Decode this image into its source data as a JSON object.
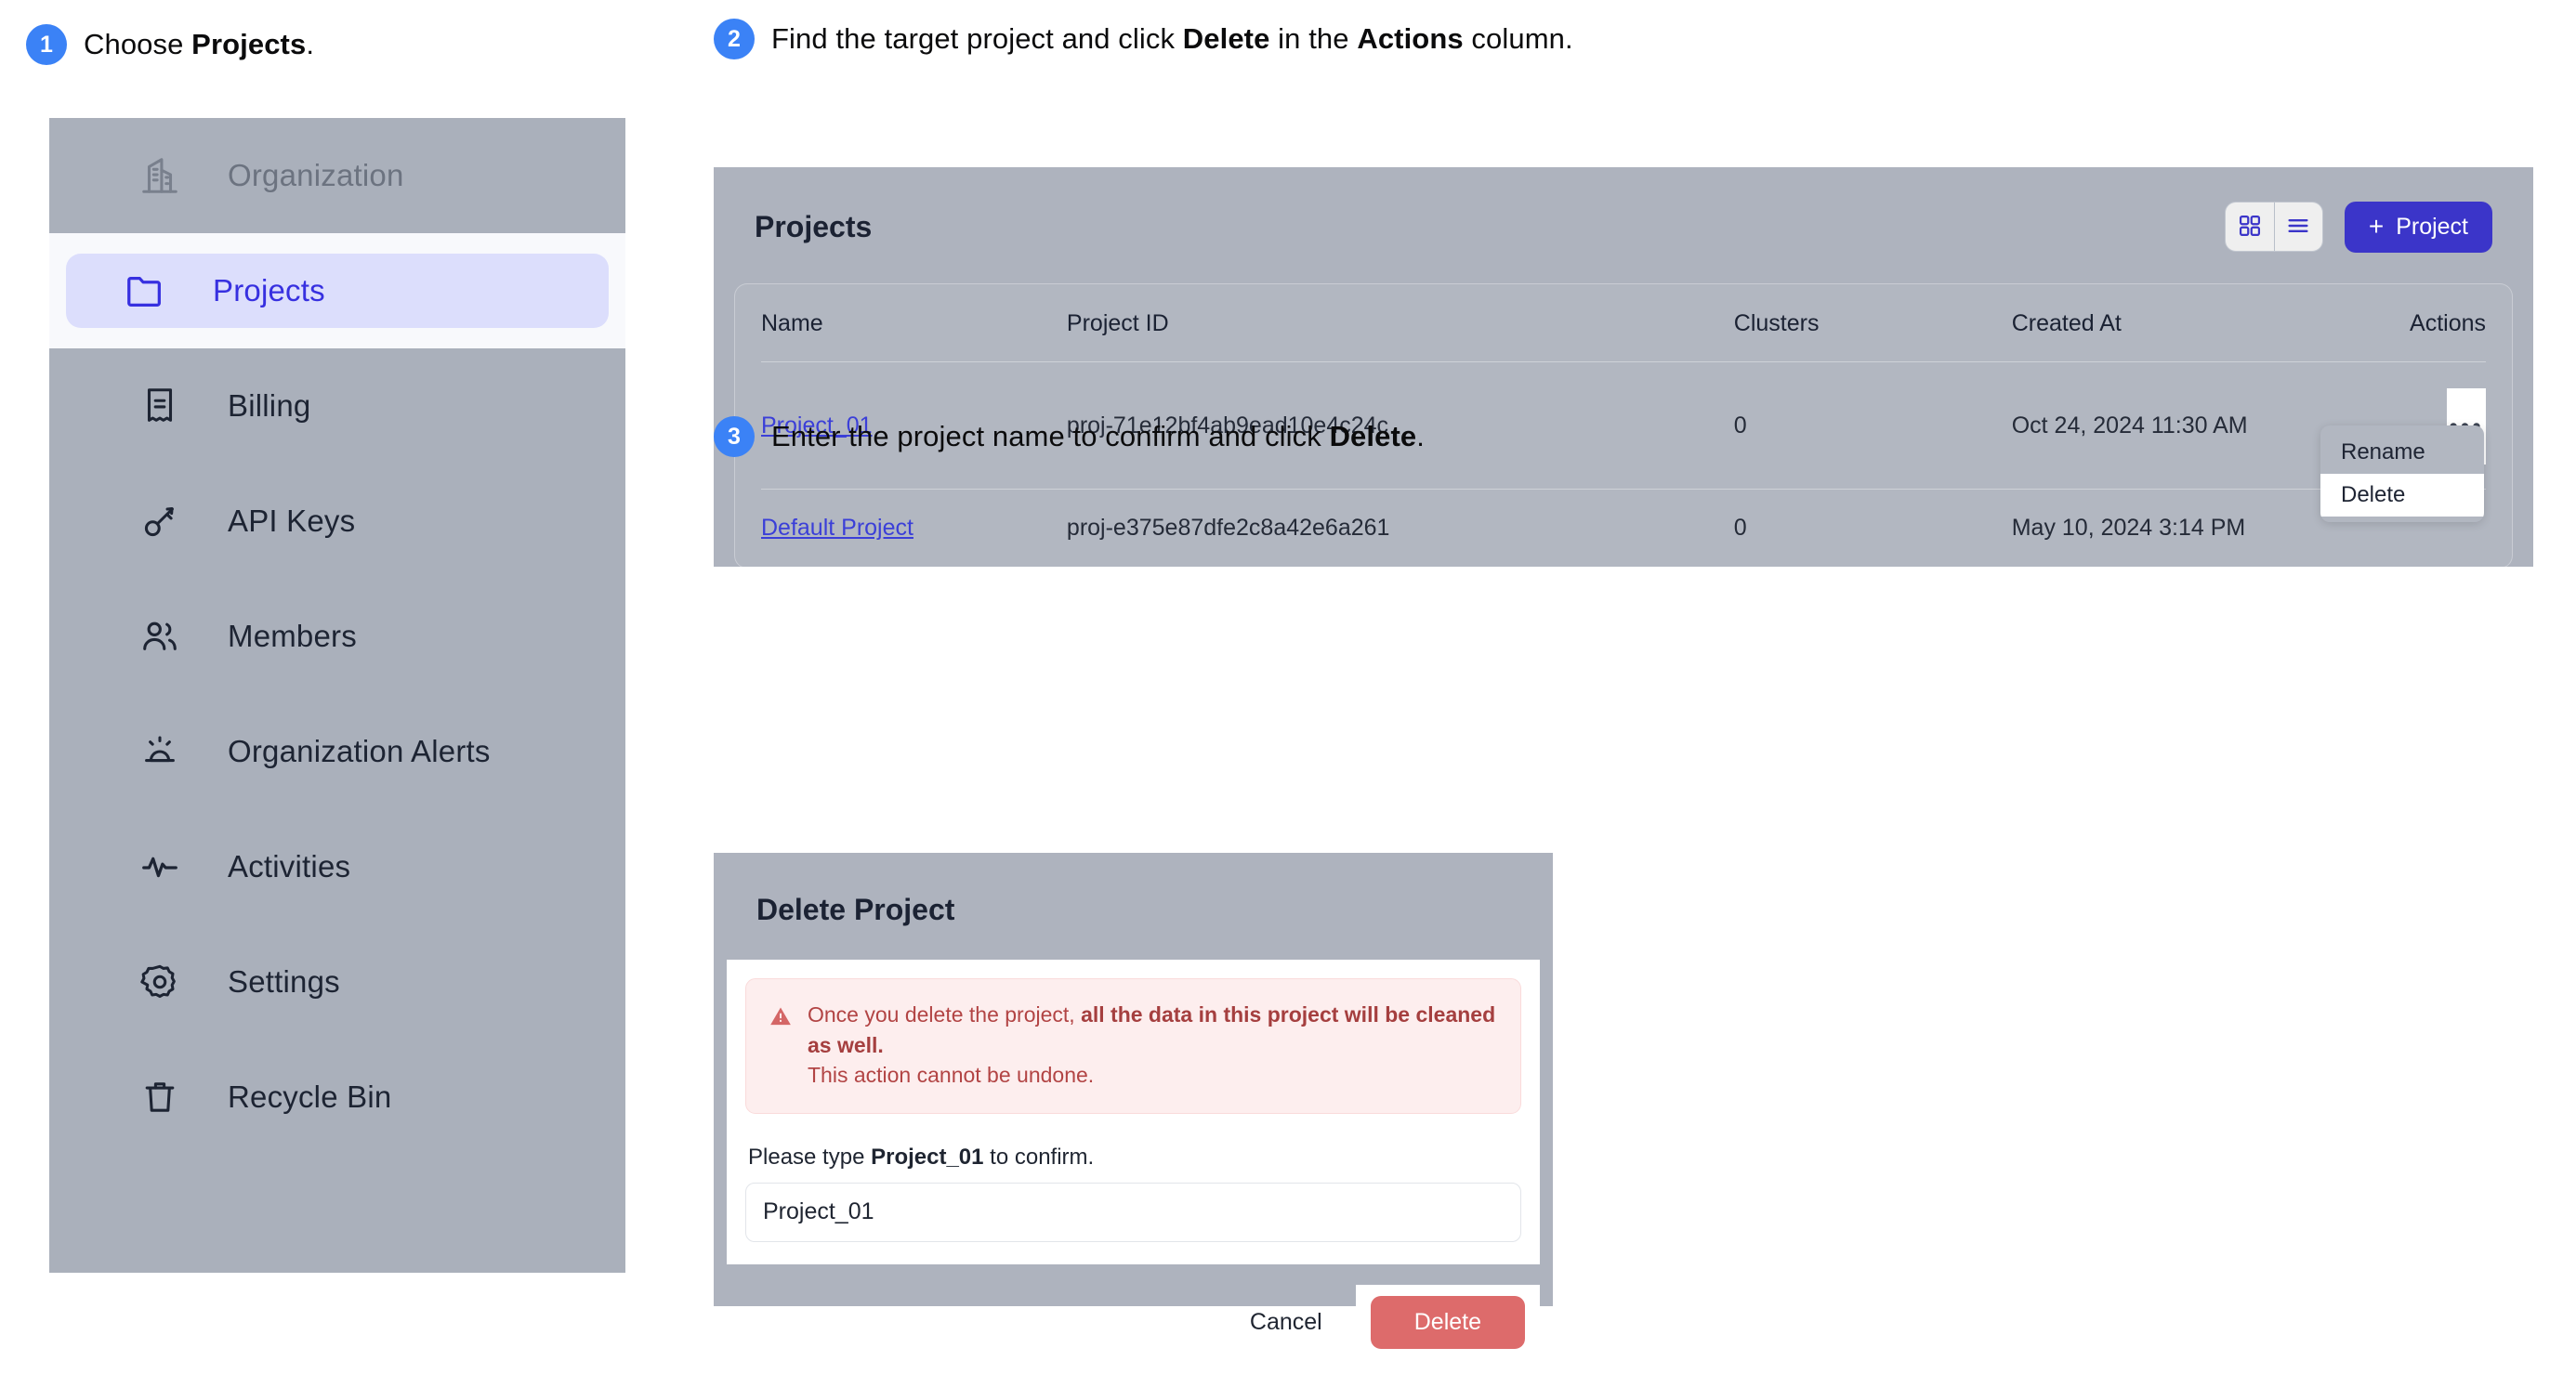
{
  "steps": [
    {
      "number": "1",
      "pre": "Choose ",
      "bold": "Projects",
      "post": "."
    },
    {
      "number": "2",
      "pre": "Find the target project and click ",
      "bold": "Delete",
      "mid": " in the ",
      "bold2": "Actions",
      "post": " column."
    },
    {
      "number": "3",
      "pre": "Enter the project name to confirm and click ",
      "bold": "Delete",
      "post": "."
    }
  ],
  "sidebar": {
    "items": [
      {
        "label": "Organization",
        "icon": "building-icon",
        "active": false,
        "muted": true
      },
      {
        "label": "Projects",
        "icon": "folder-icon",
        "active": true,
        "muted": false
      },
      {
        "label": "Billing",
        "icon": "receipt-icon",
        "active": false,
        "muted": false
      },
      {
        "label": "API Keys",
        "icon": "key-icon",
        "active": false,
        "muted": false
      },
      {
        "label": "Members",
        "icon": "users-icon",
        "active": false,
        "muted": false
      },
      {
        "label": "Organization Alerts",
        "icon": "alarm-light-icon",
        "active": false,
        "muted": false
      },
      {
        "label": "Activities",
        "icon": "activity-icon",
        "active": false,
        "muted": false
      },
      {
        "label": "Settings",
        "icon": "gear-icon",
        "active": false,
        "muted": false
      },
      {
        "label": "Recycle Bin",
        "icon": "trash-icon",
        "active": false,
        "muted": false
      }
    ]
  },
  "projects_panel": {
    "title": "Projects",
    "view_grid_icon": "grid-view-icon",
    "view_list_icon": "list-view-icon",
    "new_project_button": "Project",
    "new_project_plus": "+",
    "columns": [
      "Name",
      "Project ID",
      "Clusters",
      "Created At",
      "Actions"
    ],
    "rows": [
      {
        "name": "Project_01",
        "project_id": "proj-71e12bf4ab9ead10e4c24c",
        "clusters": "0",
        "created_at": "Oct 24, 2024 11:30 AM",
        "actions_glyph": "•••"
      },
      {
        "name": "Default Project",
        "project_id": "proj-e375e87dfe2c8a42e6a261",
        "clusters": "0",
        "created_at": "May 10, 2024 3:14 PM",
        "actions_glyph": ""
      }
    ],
    "dropdown": {
      "items": [
        {
          "label": "Rename",
          "hovered": false
        },
        {
          "label": "Delete",
          "hovered": true
        }
      ]
    }
  },
  "dialog": {
    "title": "Delete Project",
    "alert_icon": "warning-triangle-icon",
    "alert_line1_pre": "Once you delete the project, ",
    "alert_line1_bold": "all the data in this project will be cleaned as well.",
    "alert_line2": "This action cannot be undone.",
    "confirm_pre": "Please type ",
    "confirm_bold": "Project_01",
    "confirm_post": " to confirm.",
    "input_value": "Project_01",
    "input_placeholder": "Project_01",
    "cancel_label": "Cancel",
    "delete_label": "Delete"
  },
  "colors": {
    "badge_blue": "#3b82f6",
    "primary_indigo": "#3b35c9",
    "active_nav_text": "#3730e0",
    "active_nav_pill": "#dcdefc",
    "link_blue": "#3b3fd8",
    "danger_red": "#dd6b6b",
    "alert_bg": "#fdeeee",
    "alert_text": "#b24444",
    "panel_gray": "#aeb3be",
    "sidebar_gray": "#aab0bb"
  }
}
